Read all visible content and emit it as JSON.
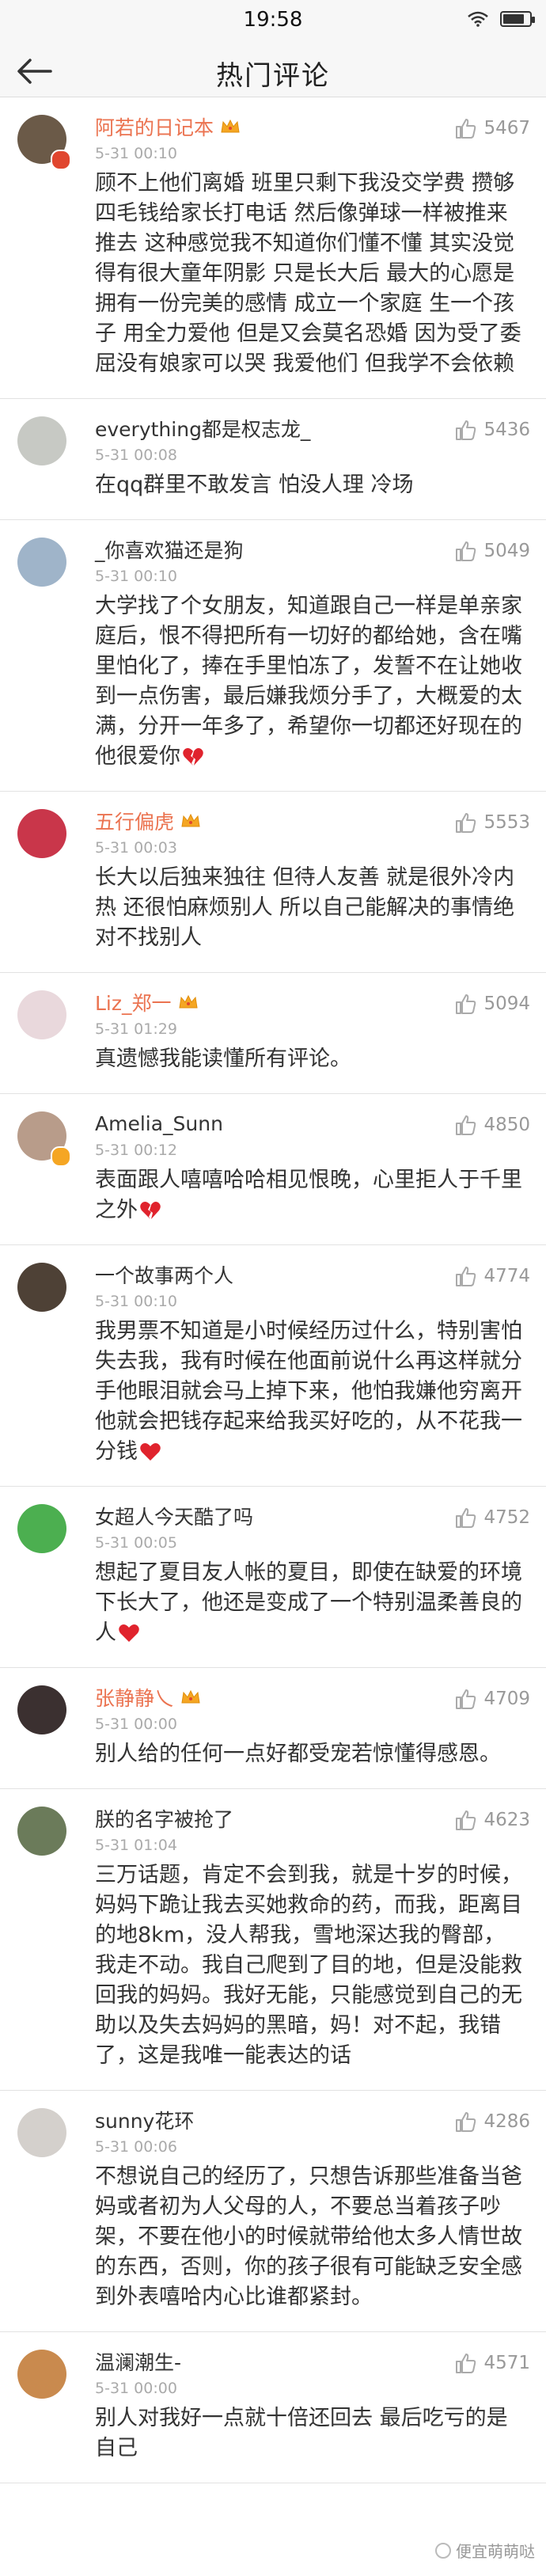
{
  "status_bar": {
    "time": "19:58",
    "battery_level": 0.8
  },
  "nav": {
    "title": "热门评论",
    "back_icon": "back-arrow-icon"
  },
  "comments": [
    {
      "user": "阿若的日记本",
      "vip": true,
      "badge": "red",
      "crown": true,
      "time": "5-31 00:10",
      "likes": "5467",
      "text": "顾不上他们离婚 班里只剩下我没交学费 攒够四毛钱给家长打电话 然后像弹球一样被推来推去 这种感觉我不知道你们懂不懂 其实没觉得有很大童年阴影 只是长大后 最大的心愿是拥有一份完美的感情 成立一个家庭 生一个孩子 用全力爱他 但是又会莫名恐婚 因为受了委屈没有娘家可以哭 我爱他们 但我学不会依赖",
      "avatar_color": "#6b5a48"
    },
    {
      "user": "everything都是权志龙_",
      "vip": false,
      "badge": "",
      "crown": false,
      "time": "5-31 00:08",
      "likes": "5436",
      "text": "在qq群里不敢发言 怕没人理 冷场",
      "avatar_color": "#c7c9c4"
    },
    {
      "user": "_你喜欢猫还是狗",
      "vip": false,
      "badge": "",
      "crown": false,
      "time": "5-31 00:10",
      "likes": "5049",
      "text": "大学找了个女朋友，知道跟自己一样是单亲家庭后，恨不得把所有一切好的都给她，含在嘴里怕化了，捧在手里怕冻了，发誓不在让她收到一点伤害，最后嫌我烦分手了，大概爱的太满，分开一年多了，希望你一切都还好现在的他很爱你",
      "heart": "broken",
      "avatar_color": "#9fb4c9"
    },
    {
      "user": "五行偏虎",
      "vip": true,
      "badge": "",
      "crown": true,
      "time": "5-31 00:03",
      "likes": "5553",
      "text": "长大以后独来独往 但待人友善 就是很外冷内热 还很怕麻烦别人 所以自己能解决的事情绝对不找别人",
      "avatar_color": "#c9364a"
    },
    {
      "user": "Liz_郑一",
      "vip": true,
      "badge": "",
      "crown": true,
      "time": "5-31 01:29",
      "likes": "5094",
      "text": "真遗憾我能读懂所有评论。",
      "avatar_color": "#e9d8dc"
    },
    {
      "user": "Amelia_Sunn",
      "vip": false,
      "badge": "yellow",
      "crown": false,
      "time": "5-31 00:12",
      "likes": "4850",
      "text": "表面跟人嘻嘻哈哈相见恨晚，心里拒人于千里之外",
      "heart": "broken",
      "avatar_color": "#b89c8a"
    },
    {
      "user": "一个故事两个人",
      "vip": false,
      "badge": "",
      "crown": false,
      "time": "5-31 00:10",
      "likes": "4774",
      "text": "我男票不知道是小时候经历过什么，特别害怕失去我，我有时候在他面前说什么再这样就分手他眼泪就会马上掉下来，他怕我嫌他穷离开他就会把钱存起来给我买好吃的，从不花我一分钱",
      "heart": "full",
      "avatar_color": "#4e4136"
    },
    {
      "user": "女超人今天酷了吗",
      "vip": false,
      "badge": "",
      "crown": false,
      "time": "5-31 00:05",
      "likes": "4752",
      "text": "想起了夏目友人帐的夏目，即使在缺爱的环境下长大了，他还是变成了一个特别温柔善良的人",
      "heart": "full",
      "avatar_color": "#4caf50"
    },
    {
      "user": "张静静乀",
      "vip": true,
      "badge": "",
      "crown": true,
      "time": "5-31 00:00",
      "likes": "4709",
      "text": "别人给的任何一点好都受宠若惊懂得感恩。",
      "avatar_color": "#3b3030"
    },
    {
      "user": "朕的名字被抢了",
      "vip": false,
      "badge": "",
      "crown": false,
      "time": "5-31 01:04",
      "likes": "4623",
      "text": "三万话题，肯定不会到我，就是十岁的时候，妈妈下跪让我去买她救命的药，而我，距离目的地8km，没人帮我，雪地深达我的臀部，我走不动。我自己爬到了目的地，但是没能救回我的妈妈。我好无能，只能感觉到自己的无助以及失去妈妈的黑暗，妈！对不起，我错了，这是我唯一能表达的话",
      "avatar_color": "#6b7b5a"
    },
    {
      "user": "sunny花环",
      "vip": false,
      "badge": "",
      "crown": false,
      "time": "5-31 00:06",
      "likes": "4286",
      "text": "不想说自己的经历了，只想告诉那些准备当爸妈或者初为人父母的人，不要总当着孩子吵架，不要在他小的时候就带给他太多人情世故的东西，否则，你的孩子很有可能缺乏安全感到外表嘻哈内心比谁都紧封。",
      "avatar_color": "#d4d0cc"
    },
    {
      "user": "温澜潮生-",
      "vip": false,
      "badge": "",
      "crown": false,
      "time": "5-31 00:00",
      "likes": "4571",
      "text": "别人对我好一点就十倍还回去 最后吃亏的是自己",
      "avatar_color": "#c98a4e"
    }
  ],
  "watermark": {
    "text": "便宜萌萌哒",
    "icon": "weibo-logo-icon"
  },
  "colors": {
    "vip_name": "#eb7350",
    "normal_name": "#333333",
    "divider": "#e2e2e2",
    "heart": "#e0232d"
  }
}
